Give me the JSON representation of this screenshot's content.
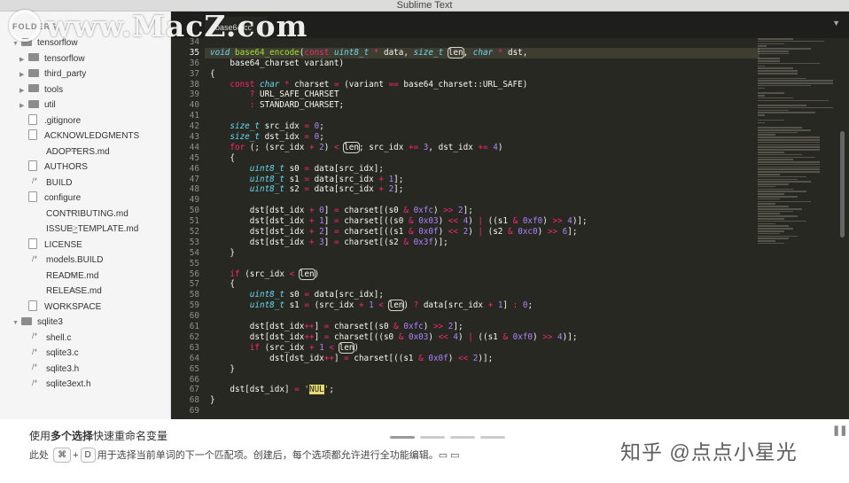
{
  "window": {
    "title": "Sublime Text"
  },
  "watermark": {
    "text": "www.MacZ.com"
  },
  "sidebar": {
    "header": "FOLDERS",
    "items": [
      {
        "label": "tensorflow",
        "kind": "folder",
        "level": 0,
        "expanded": true
      },
      {
        "label": "tensorflow",
        "kind": "folder",
        "level": 1
      },
      {
        "label": "third_party",
        "kind": "folder",
        "level": 1
      },
      {
        "label": "tools",
        "kind": "folder",
        "level": 1
      },
      {
        "label": "util",
        "kind": "folder",
        "level": 1
      },
      {
        "label": ".gitignore",
        "kind": "file",
        "level": 1
      },
      {
        "label": "ACKNOWLEDGMENTS",
        "kind": "file",
        "level": 1
      },
      {
        "label": "ADOPTERS.md",
        "kind": "code",
        "level": 1
      },
      {
        "label": "AUTHORS",
        "kind": "file",
        "level": 1
      },
      {
        "label": "BUILD",
        "kind": "hash",
        "level": 1
      },
      {
        "label": "configure",
        "kind": "file",
        "level": 1
      },
      {
        "label": "CONTRIBUTING.md",
        "kind": "code",
        "level": 1
      },
      {
        "label": "ISSUE_TEMPLATE.md",
        "kind": "code",
        "level": 1
      },
      {
        "label": "LICENSE",
        "kind": "file",
        "level": 1
      },
      {
        "label": "models.BUILD",
        "kind": "hash",
        "level": 1
      },
      {
        "label": "README.md",
        "kind": "code",
        "level": 1
      },
      {
        "label": "RELEASE.md",
        "kind": "code",
        "level": 1
      },
      {
        "label": "WORKSPACE",
        "kind": "file",
        "level": 1
      },
      {
        "label": "sqlite3",
        "kind": "folder",
        "level": 0,
        "expanded": true
      },
      {
        "label": "shell.c",
        "kind": "hash",
        "level": 1
      },
      {
        "label": "sqlite3.c",
        "kind": "hash",
        "level": 1
      },
      {
        "label": "sqlite3.h",
        "kind": "hash",
        "level": 1
      },
      {
        "label": "sqlite3ext.h",
        "kind": "hash",
        "level": 1
      }
    ]
  },
  "editor": {
    "tab": "base64.cc",
    "current_line": 35,
    "lines": [
      {
        "n": 34,
        "html": ""
      },
      {
        "n": 35,
        "html": "<span class=\"t\">void</span> <span class=\"f\">base64_encode</span>(<span class=\"k\">const</span> <span class=\"t\">uint8_t</span> <span class=\"k\">*</span> data, <span class=\"t\">size_t</span> <span class=\"bx\">len</span>, <span class=\"t\">char</span> <span class=\"k\">*</span> dst,"
      },
      {
        "n": 36,
        "html": "    base64_charset variant)"
      },
      {
        "n": 37,
        "html": "{"
      },
      {
        "n": 38,
        "html": "    <span class=\"k\">const</span> <span class=\"t\">char</span> <span class=\"k\">*</span> charset <span class=\"k\">=</span> (variant <span class=\"k\">==</span> base64_charset::URL_SAFE)"
      },
      {
        "n": 39,
        "html": "        <span class=\"k\">?</span> URL_SAFE_CHARSET"
      },
      {
        "n": 40,
        "html": "        <span class=\"k\">:</span> STANDARD_CHARSET;"
      },
      {
        "n": 41,
        "html": ""
      },
      {
        "n": 42,
        "html": "    <span class=\"t\">size_t</span> src_idx <span class=\"k\">=</span> <span class=\"n\">0</span>;"
      },
      {
        "n": 43,
        "html": "    <span class=\"t\">size_t</span> dst_idx <span class=\"k\">=</span> <span class=\"n\">0</span>;"
      },
      {
        "n": 44,
        "html": "    <span class=\"k\">for</span> (; (src_idx <span class=\"k\">+</span> <span class=\"n\">2</span>) <span class=\"k\">&lt;</span> <span class=\"bx\">len</span>; src_idx <span class=\"k\">+=</span> <span class=\"n\">3</span>, dst_idx <span class=\"k\">+=</span> <span class=\"n\">4</span>)"
      },
      {
        "n": 45,
        "html": "    {"
      },
      {
        "n": 46,
        "html": "        <span class=\"t\">uint8_t</span> s0 <span class=\"k\">=</span> data[src_idx];"
      },
      {
        "n": 47,
        "html": "        <span class=\"t\">uint8_t</span> s1 <span class=\"k\">=</span> data[src_idx <span class=\"k\">+</span> <span class=\"n\">1</span>];"
      },
      {
        "n": 48,
        "html": "        <span class=\"t\">uint8_t</span> s2 <span class=\"k\">=</span> data[src_idx <span class=\"k\">+</span> <span class=\"n\">2</span>];"
      },
      {
        "n": 49,
        "html": ""
      },
      {
        "n": 50,
        "html": "        dst[dst_idx <span class=\"k\">+</span> <span class=\"n\">0</span>] <span class=\"k\">=</span> charset[(s0 <span class=\"k\">&amp;</span> <span class=\"n\">0xfc</span>) <span class=\"k\">&gt;&gt;</span> <span class=\"n\">2</span>];"
      },
      {
        "n": 51,
        "html": "        dst[dst_idx <span class=\"k\">+</span> <span class=\"n\">1</span>] <span class=\"k\">=</span> charset[((s0 <span class=\"k\">&amp;</span> <span class=\"n\">0x03</span>) <span class=\"k\">&lt;&lt;</span> <span class=\"n\">4</span>) <span class=\"k\">|</span> ((s1 <span class=\"k\">&amp;</span> <span class=\"n\">0xf0</span>) <span class=\"k\">&gt;&gt;</span> <span class=\"n\">4</span>)];"
      },
      {
        "n": 52,
        "html": "        dst[dst_idx <span class=\"k\">+</span> <span class=\"n\">2</span>] <span class=\"k\">=</span> charset[((s1 <span class=\"k\">&amp;</span> <span class=\"n\">0x0f</span>) <span class=\"k\">&lt;&lt;</span> <span class=\"n\">2</span>) <span class=\"k\">|</span> (s2 <span class=\"k\">&amp;</span> <span class=\"n\">0xc0</span>) <span class=\"k\">&gt;&gt;</span> <span class=\"n\">6</span>];"
      },
      {
        "n": 53,
        "html": "        dst[dst_idx <span class=\"k\">+</span> <span class=\"n\">3</span>] <span class=\"k\">=</span> charset[(s2 <span class=\"k\">&amp;</span> <span class=\"n\">0x3f</span>)];"
      },
      {
        "n": 54,
        "html": "    }"
      },
      {
        "n": 55,
        "html": ""
      },
      {
        "n": 56,
        "html": "    <span class=\"k\">if</span> (src_idx <span class=\"k\">&lt;</span> <span class=\"bx\">len</span>)"
      },
      {
        "n": 57,
        "html": "    {"
      },
      {
        "n": 58,
        "html": "        <span class=\"t\">uint8_t</span> s0 <span class=\"k\">=</span> data[src_idx];"
      },
      {
        "n": 59,
        "html": "        <span class=\"t\">uint8_t</span> s1 <span class=\"k\">=</span> (src_idx <span class=\"k\">+</span> <span class=\"n\">1</span> <span class=\"k\">&lt;</span> <span class=\"bx\">len</span>) <span class=\"k\">?</span> data[src_idx <span class=\"k\">+</span> <span class=\"n\">1</span>] <span class=\"k\">:</span> <span class=\"n\">0</span>;"
      },
      {
        "n": 60,
        "html": ""
      },
      {
        "n": 61,
        "html": "        dst[dst_idx<span class=\"k\">++</span>] <span class=\"k\">=</span> charset[(s0 <span class=\"k\">&amp;</span> <span class=\"n\">0xfc</span>) <span class=\"k\">&gt;&gt;</span> <span class=\"n\">2</span>];"
      },
      {
        "n": 62,
        "html": "        dst[dst_idx<span class=\"k\">++</span>] <span class=\"k\">=</span> charset[((s0 <span class=\"k\">&amp;</span> <span class=\"n\">0x03</span>) <span class=\"k\">&lt;&lt;</span> <span class=\"n\">4</span>) <span class=\"k\">|</span> ((s1 <span class=\"k\">&amp;</span> <span class=\"n\">0xf0</span>) <span class=\"k\">&gt;&gt;</span> <span class=\"n\">4</span>)];"
      },
      {
        "n": 63,
        "html": "        <span class=\"k\">if</span> (src_idx <span class=\"k\">+</span> <span class=\"n\">1</span> <span class=\"k\">&lt;</span> <span class=\"bx\">len</span>)"
      },
      {
        "n": 64,
        "html": "            dst[dst_idx<span class=\"k\">++</span>] <span class=\"k\">=</span> charset[((s1 <span class=\"k\">&amp;</span> <span class=\"n\">0x0f</span>) <span class=\"k\">&lt;&lt;</span> <span class=\"n\">2</span>)];"
      },
      {
        "n": 65,
        "html": "    }"
      },
      {
        "n": 66,
        "html": ""
      },
      {
        "n": 67,
        "html": "    dst[dst_idx] <span class=\"k\">=</span> <span class=\"s\">'<span class=\"hl\">NUL</span>'</span>;"
      },
      {
        "n": 68,
        "html": "}"
      },
      {
        "n": 69,
        "html": ""
      }
    ]
  },
  "tip": {
    "prefix": "使用",
    "emphasis": "多个选择",
    "suffix": "快速重命名变量",
    "line2_prefix": "此处",
    "key1": "⌘",
    "plus": "+",
    "key2": "D",
    "line2_suffix": "用于选择当前单词的下一个匹配项。创建后，每个选项都允许进行全功能编辑。▭ ▭"
  },
  "pager": {
    "pages": 4,
    "active": 0
  },
  "zhihu_watermark": "知乎 @点点小星光"
}
